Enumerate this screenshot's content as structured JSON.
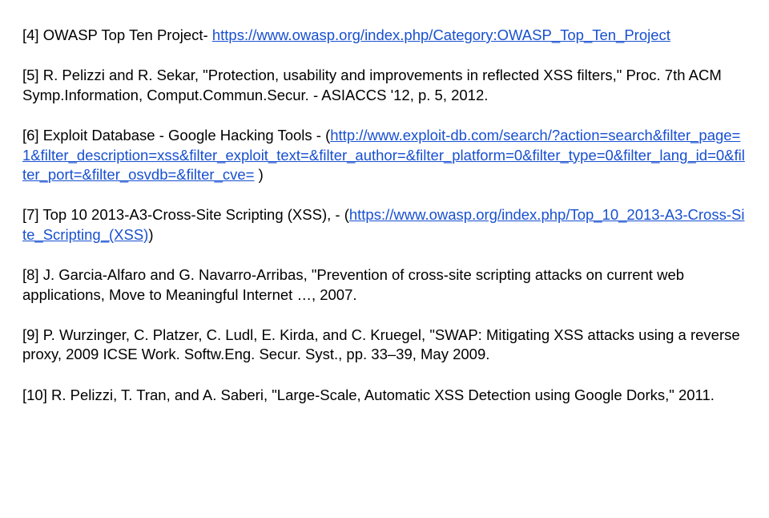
{
  "refs": {
    "r4": {
      "pre": "[4] OWASP Top Ten Project- ",
      "link": "https://www.owasp.org/index.php/Category:OWASP_Top_Ten_Project"
    },
    "r5": {
      "text": "[5] R. Pelizzi and R. Sekar, \"Protection, usability and improvements in reflected XSS filters,\" Proc. 7th ACM Symp.Information, Comput.Commun.Secur. - ASIACCS '12, p. 5, 2012."
    },
    "r6": {
      "pre": "[6] Exploit Database - Google Hacking Tools - (",
      "link1": "http://www.exploit-db.com/search/?action=search&filter_page=1&filter_description=xss&filter_exploit_text=&filter_author=&filter_platform=0&filter_type=0&filter_lang_id=0&filter_port=&filter_osvdb=&filter_cve=",
      "post": ")"
    },
    "r7": {
      "pre": "[7] Top 10 2013-A3-Cross-Site Scripting (XSS), - (",
      "link": "https://www.owasp.org/index.php/Top_10_2013-A3-Cross-Site_Scripting_(XSS)",
      "post": ")"
    },
    "r8": {
      "text": "[8] J. Garcia-Alfaro and G. Navarro-Arribas, \"Prevention of cross-site scripting attacks on current web applications, Move to Meaningful Internet …, 2007."
    },
    "r9": {
      "text": "[9] P. Wurzinger, C. Platzer, C. Ludl, E. Kirda, and C. Kruegel, \"SWAP: Mitigating XSS attacks using a reverse proxy, 2009 ICSE Work. Softw.Eng. Secur. Syst., pp. 33–39, May 2009."
    },
    "r10": {
      "text": "[10] R. Pelizzi, T. Tran, and A. Saberi, \"Large-Scale, Automatic XSS Detection using Google Dorks,\" 2011."
    }
  }
}
